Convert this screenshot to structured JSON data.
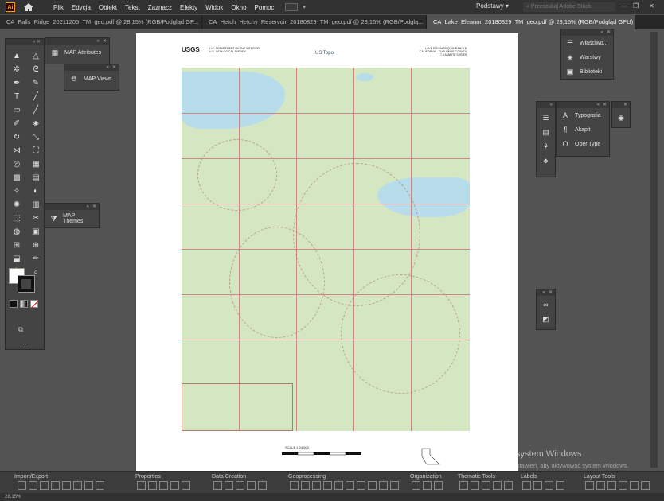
{
  "app": {
    "logo": "Ai"
  },
  "menu": [
    "Plik",
    "Edycja",
    "Obiekt",
    "Tekst",
    "Zaznacz",
    "Efekty",
    "Widok",
    "Okno",
    "Pomoc"
  ],
  "workspace": "Podstawy",
  "search": {
    "placeholder": "Przeszukaj Adobe Stock"
  },
  "tabs": [
    {
      "label": "CA_Falls_Ridge_20211205_TM_geo.pdf @ 28,15% (RGB/Podgląd GP...",
      "active": false
    },
    {
      "label": "CA_Hetch_Hetchy_Reservoir_20180829_TM_geo.pdf @ 28,15% (RGB/Podglą...",
      "active": false
    },
    {
      "label": "CA_Lake_Eleanor_20180829_TM_geo.pdf @ 28,15% (RGB/Podgląd GPU)",
      "active": true
    }
  ],
  "panels": {
    "map_attributes": "MAP Attributes",
    "map_views": "MAP Views",
    "map_themes": "MAP Themes",
    "right_top": [
      "Właściwo...",
      "Warstwy",
      "Biblioteki"
    ],
    "right_mid": [
      "Typografia",
      "Akapit",
      "OpenType"
    ]
  },
  "map": {
    "header_left": "U.S. DEPARTMENT OF THE INTERIOR\nU.S. GEOLOGICAL SURVEY",
    "header_center": "US Topo",
    "header_right": "LAKE ELEANOR QUADRANGLE\nCALIFORNIA - TUOLUMNE COUNTY\n7.5-MINUTE SERIES",
    "usgs": "USGS",
    "scale": "SCALE 1:24 000"
  },
  "bottom_groups": [
    "Import/Export",
    "Properties",
    "Data Creation",
    "Geoprocessing",
    "Organization",
    "Thematic Tools",
    "Labels",
    "Layout Tools"
  ],
  "watermark": {
    "line1": "Aktywuj system Windows",
    "line2": "Przejdź do ustawień, aby aktywować system Windows."
  },
  "status": "28,15%",
  "colors": {
    "accent": "#ff9a00",
    "menubar": "#323232",
    "canvas": "#535353"
  }
}
